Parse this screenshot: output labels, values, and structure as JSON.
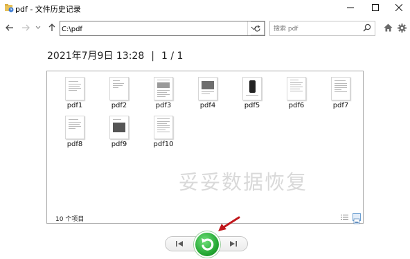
{
  "window": {
    "title": "pdf - 文件历史记录"
  },
  "nav": {
    "address": "C:\\pdf",
    "search_placeholder": "搜索 pdf"
  },
  "header": {
    "date": "2021年7月9日 13:28",
    "separator": "|",
    "page": "1 / 1"
  },
  "files": [
    {
      "name": "pdf1",
      "thumb": "text"
    },
    {
      "name": "pdf2",
      "thumb": "text"
    },
    {
      "name": "pdf3",
      "thumb": "text-photo"
    },
    {
      "name": "pdf4",
      "thumb": "photo"
    },
    {
      "name": "pdf5",
      "thumb": "phone"
    },
    {
      "name": "pdf6",
      "thumb": "text"
    },
    {
      "name": "pdf7",
      "thumb": "text"
    },
    {
      "name": "pdf8",
      "thumb": "text"
    },
    {
      "name": "pdf9",
      "thumb": "photo-dark"
    },
    {
      "name": "pdf10",
      "thumb": "text"
    }
  ],
  "status": {
    "item_count": "10 个项目"
  },
  "watermark": "妥妥数据恢复",
  "colors": {
    "restore_green": "#22a531",
    "annotation_red": "#c0161b",
    "selected_view": "#6c9fd1"
  }
}
